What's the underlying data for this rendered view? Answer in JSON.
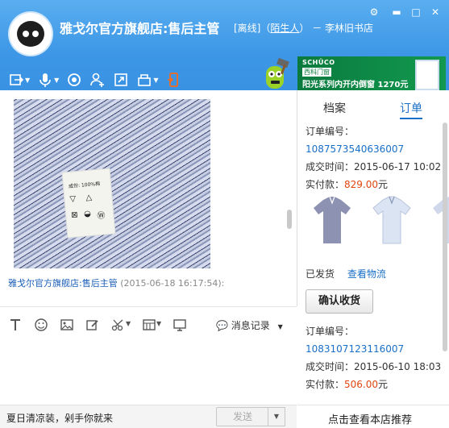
{
  "window": {
    "title": "雅戈尔官方旗舰店:售后主管",
    "status_open": "[离线]（",
    "stranger": "陌生人",
    "status_close": "）",
    "location": "－ 李林旧书店",
    "controls": {
      "gear": "⚙",
      "minimize": "▬",
      "maximize": "□",
      "close": "✕"
    }
  },
  "toolbar": {
    "icons": [
      "transfer-file-icon",
      "voice-icon",
      "video-icon",
      "add-contact-icon",
      "share-screen-icon",
      "remote-desktop-icon",
      "mobile-icon"
    ]
  },
  "ad": {
    "brand": "SCHÜCO",
    "brand_sub": "西科门窗",
    "slogan": "阳光系列内开内倒窗 1270元"
  },
  "message": {
    "tag_text": "成份: 100%棉",
    "sender": "雅戈尔官方旗舰店:售后主管",
    "timestamp": "(2015-06-18 16:17:54):"
  },
  "editor": {
    "history_label": "消息记录"
  },
  "bottom": {
    "promo": "夏日清凉装，剁手你就来",
    "send_label": "发送"
  },
  "panel": {
    "tabs": [
      "档案",
      "订单"
    ],
    "order1": {
      "no_label": "订单编号：",
      "no": "1087573540636007",
      "time_label": "成交时间：",
      "time": "2015-06-17 10:02",
      "pay_label": "实付款：",
      "amount": "829.00",
      "currency": "元"
    },
    "shipped": "已发货",
    "logistics": "查看物流",
    "confirm": "确认收货",
    "order2": {
      "no_label": "订单编号：",
      "no": "1083107123116007",
      "time_label": "成交时间：",
      "time": "2015-06-10 18:03",
      "pay_label": "实付款：",
      "amount": "506.00",
      "currency": "元"
    },
    "store_link": "点击查看本店推荐"
  },
  "colors": {
    "titlebar": "#3d97e6",
    "link": "#1a6fc7",
    "price": "#e0450f",
    "ad": "#0a7a3e"
  }
}
